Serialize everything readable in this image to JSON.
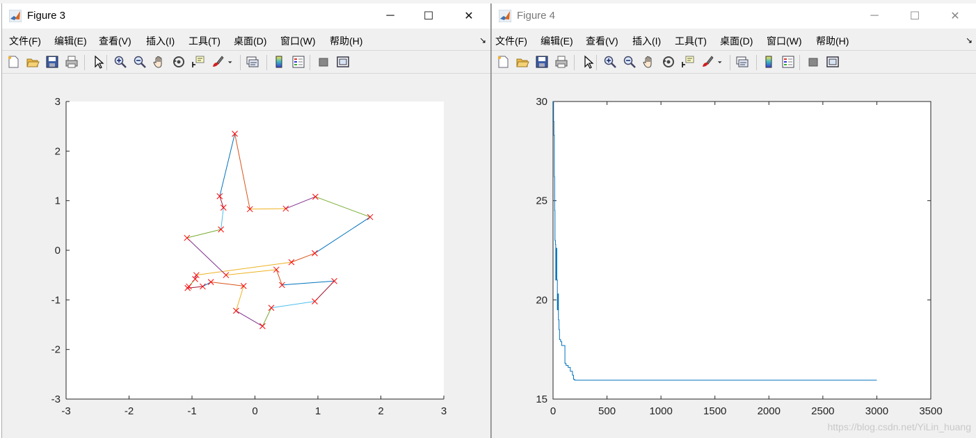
{
  "figures": [
    {
      "title": "Figure 3",
      "menu": [
        "文件(F)",
        "编辑(E)",
        "查看(V)",
        "插入(I)",
        "工具(T)",
        "桌面(D)",
        "窗口(W)",
        "帮助(H)"
      ],
      "toolbar_icons": [
        "new-figure-icon",
        "open-file-icon",
        "save-icon",
        "print-icon",
        "select-arrow-icon",
        "zoom-in-icon",
        "zoom-out-icon",
        "pan-hand-icon",
        "rotate-3d-icon",
        "data-cursor-icon",
        "brush-icon",
        "brush-dropdown-icon",
        "link-plot-icon",
        "colorbar-icon",
        "legend-icon",
        "hide-plot-tools-icon",
        "show-plot-tools-icon"
      ]
    },
    {
      "title": "Figure 4",
      "menu": [
        "文件(F)",
        "编辑(E)",
        "查看(V)",
        "插入(I)",
        "工具(T)",
        "桌面(D)",
        "窗口(W)",
        "帮助(H)"
      ],
      "toolbar_icons": [
        "new-figure-icon",
        "open-file-icon",
        "save-icon",
        "print-icon",
        "select-arrow-icon",
        "zoom-in-icon",
        "zoom-out-icon",
        "pan-hand-icon",
        "rotate-3d-icon",
        "data-cursor-icon",
        "brush-icon",
        "brush-dropdown-icon",
        "link-plot-icon",
        "colorbar-icon",
        "legend-icon",
        "hide-plot-tools-icon",
        "show-plot-tools-icon"
      ]
    }
  ],
  "window_controls": {
    "minimize": "─",
    "maximize": "☐",
    "close": "✕"
  },
  "menu_overflow": "↘",
  "watermark": "https://blog.csdn.net/YiLin_huang",
  "colors": {
    "matlab_order": [
      "#0072BD",
      "#D95319",
      "#EDB120",
      "#7E2F8E",
      "#77AC30",
      "#4DBEEE",
      "#A2142F"
    ],
    "marker": "#FF0000",
    "line": "#0072BD"
  },
  "chart_data": [
    {
      "type": "line",
      "title": "",
      "xlabel": "",
      "ylabel": "",
      "xlim": [
        -3,
        3
      ],
      "ylim": [
        -3,
        3
      ],
      "xticks": [
        -3,
        -2,
        -1,
        0,
        1,
        2,
        3
      ],
      "yticks": [
        -3,
        -2,
        -1,
        0,
        1,
        2,
        3
      ],
      "marker": "x",
      "closed": true,
      "points": [
        [
          1.83,
          0.67
        ],
        [
          0.95,
          -0.06
        ],
        [
          0.58,
          -0.24
        ],
        [
          -0.93,
          -0.5
        ],
        [
          -0.95,
          -0.58
        ],
        [
          -1.05,
          -0.73
        ],
        [
          -1.07,
          -0.76
        ],
        [
          -0.83,
          -0.73
        ],
        [
          -0.7,
          -0.64
        ],
        [
          -0.18,
          -0.72
        ],
        [
          -0.3,
          -1.22
        ],
        [
          0.12,
          -1.53
        ],
        [
          0.26,
          -1.16
        ],
        [
          0.95,
          -1.03
        ],
        [
          1.26,
          -0.62
        ],
        [
          0.43,
          -0.7
        ],
        [
          0.34,
          -0.39
        ],
        [
          -0.46,
          -0.5
        ],
        [
          -1.08,
          0.25
        ],
        [
          -0.54,
          0.42
        ],
        [
          -0.5,
          0.86
        ],
        [
          -0.56,
          1.09
        ],
        [
          -0.32,
          2.35
        ],
        [
          -0.08,
          0.83
        ],
        [
          0.49,
          0.84
        ],
        [
          0.96,
          1.08
        ]
      ]
    },
    {
      "type": "line",
      "title": "",
      "xlabel": "",
      "ylabel": "",
      "xlim": [
        0,
        3500
      ],
      "ylim": [
        15,
        30
      ],
      "xticks": [
        0,
        500,
        1000,
        1500,
        2000,
        2500,
        3000,
        3500
      ],
      "yticks": [
        15,
        20,
        25,
        30
      ],
      "x": [
        0,
        5,
        8,
        12,
        15,
        18,
        22,
        25,
        30,
        35,
        40,
        45,
        50,
        55,
        60,
        70,
        80,
        100,
        110,
        120,
        140,
        160,
        180,
        190,
        200,
        250,
        3000
      ],
      "y": [
        30.0,
        29.0,
        28.3,
        26.2,
        24.5,
        23.0,
        22.8,
        21.0,
        22.6,
        21.0,
        19.5,
        20.3,
        19.0,
        18.5,
        18.0,
        17.9,
        17.7,
        17.7,
        16.8,
        16.7,
        16.6,
        16.4,
        16.2,
        16.0,
        15.95,
        15.95,
        15.95
      ]
    }
  ]
}
